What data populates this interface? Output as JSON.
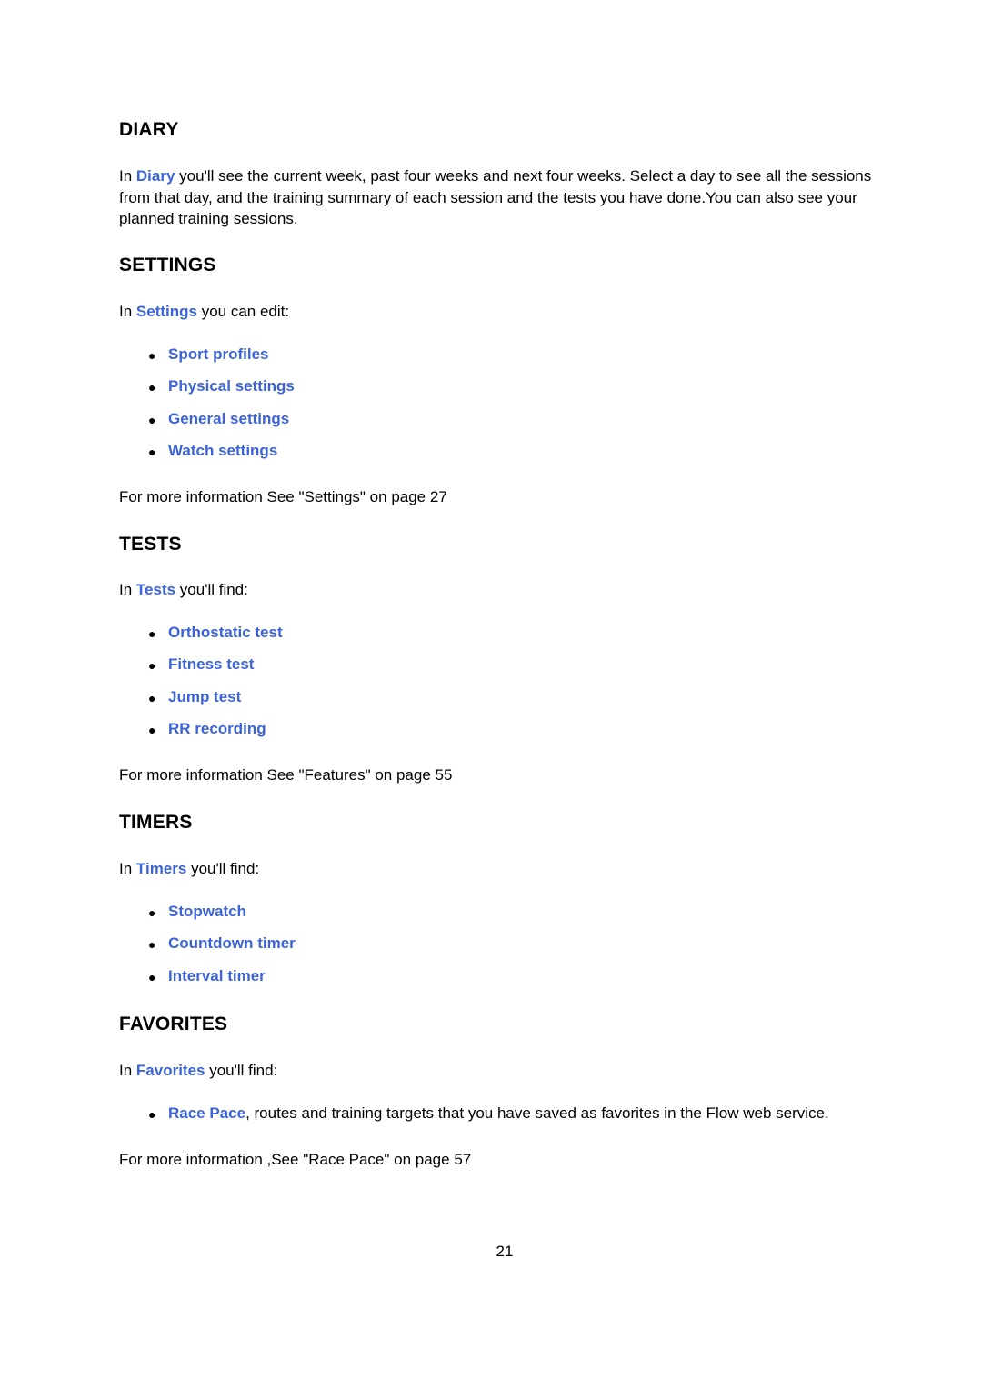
{
  "page_number": "21",
  "colors": {
    "link": "#3d63d9",
    "text": "#000000"
  },
  "sections": {
    "diary": {
      "heading": "DIARY",
      "intro_prefix": "In ",
      "intro_link": "Diary",
      "intro_suffix": " you'll see the current week, past four weeks and next four weeks. Select a day to see all the sessions from that day, and the training summary of each session and the tests you have done.You can also see your planned training sessions."
    },
    "settings": {
      "heading": "SETTINGS",
      "intro_prefix": "In ",
      "intro_link": "Settings",
      "intro_suffix": " you can edit:",
      "items": [
        "Sport profiles",
        "Physical settings",
        "General settings",
        "Watch settings"
      ],
      "more_info": "For more information See \"Settings\" on page 27"
    },
    "tests": {
      "heading": "TESTS",
      "intro_prefix": "In ",
      "intro_link": "Tests",
      "intro_suffix": " you'll find:",
      "items": [
        "Orthostatic test",
        "Fitness test",
        "Jump test",
        "RR recording"
      ],
      "more_info": "For more information See \"Features\" on page 55"
    },
    "timers": {
      "heading": "TIMERS",
      "intro_prefix": "In ",
      "intro_link": "Timers",
      "intro_suffix": " you'll find:",
      "items": [
        "Stopwatch",
        "Countdown timer",
        "Interval timer"
      ]
    },
    "favorites": {
      "heading": "FAVORITES",
      "intro_prefix": "In ",
      "intro_link": "Favorites",
      "intro_suffix": " you'll find:",
      "items": [
        {
          "link": "Race Pace",
          "text": ", routes and training targets that you have saved as favorites in the Flow web service."
        }
      ],
      "more_info": "For more information ,See \"Race Pace\" on page 57"
    }
  },
  "bullet_glyph": "●"
}
